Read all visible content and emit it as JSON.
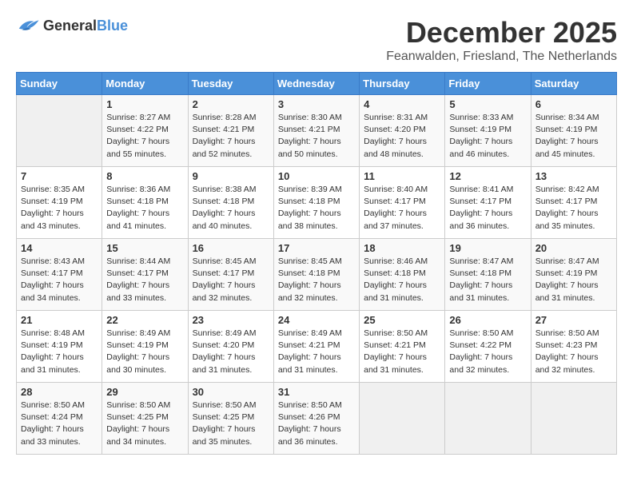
{
  "logo": {
    "general": "General",
    "blue": "Blue"
  },
  "title": "December 2025",
  "location": "Feanwalden, Friesland, The Netherlands",
  "days_of_week": [
    "Sunday",
    "Monday",
    "Tuesday",
    "Wednesday",
    "Thursday",
    "Friday",
    "Saturday"
  ],
  "weeks": [
    [
      {
        "day": "",
        "sunrise": "",
        "sunset": "",
        "daylight": ""
      },
      {
        "day": "1",
        "sunrise": "Sunrise: 8:27 AM",
        "sunset": "Sunset: 4:22 PM",
        "daylight": "Daylight: 7 hours and 55 minutes."
      },
      {
        "day": "2",
        "sunrise": "Sunrise: 8:28 AM",
        "sunset": "Sunset: 4:21 PM",
        "daylight": "Daylight: 7 hours and 52 minutes."
      },
      {
        "day": "3",
        "sunrise": "Sunrise: 8:30 AM",
        "sunset": "Sunset: 4:21 PM",
        "daylight": "Daylight: 7 hours and 50 minutes."
      },
      {
        "day": "4",
        "sunrise": "Sunrise: 8:31 AM",
        "sunset": "Sunset: 4:20 PM",
        "daylight": "Daylight: 7 hours and 48 minutes."
      },
      {
        "day": "5",
        "sunrise": "Sunrise: 8:33 AM",
        "sunset": "Sunset: 4:19 PM",
        "daylight": "Daylight: 7 hours and 46 minutes."
      },
      {
        "day": "6",
        "sunrise": "Sunrise: 8:34 AM",
        "sunset": "Sunset: 4:19 PM",
        "daylight": "Daylight: 7 hours and 45 minutes."
      }
    ],
    [
      {
        "day": "7",
        "sunrise": "Sunrise: 8:35 AM",
        "sunset": "Sunset: 4:19 PM",
        "daylight": "Daylight: 7 hours and 43 minutes."
      },
      {
        "day": "8",
        "sunrise": "Sunrise: 8:36 AM",
        "sunset": "Sunset: 4:18 PM",
        "daylight": "Daylight: 7 hours and 41 minutes."
      },
      {
        "day": "9",
        "sunrise": "Sunrise: 8:38 AM",
        "sunset": "Sunset: 4:18 PM",
        "daylight": "Daylight: 7 hours and 40 minutes."
      },
      {
        "day": "10",
        "sunrise": "Sunrise: 8:39 AM",
        "sunset": "Sunset: 4:18 PM",
        "daylight": "Daylight: 7 hours and 38 minutes."
      },
      {
        "day": "11",
        "sunrise": "Sunrise: 8:40 AM",
        "sunset": "Sunset: 4:17 PM",
        "daylight": "Daylight: 7 hours and 37 minutes."
      },
      {
        "day": "12",
        "sunrise": "Sunrise: 8:41 AM",
        "sunset": "Sunset: 4:17 PM",
        "daylight": "Daylight: 7 hours and 36 minutes."
      },
      {
        "day": "13",
        "sunrise": "Sunrise: 8:42 AM",
        "sunset": "Sunset: 4:17 PM",
        "daylight": "Daylight: 7 hours and 35 minutes."
      }
    ],
    [
      {
        "day": "14",
        "sunrise": "Sunrise: 8:43 AM",
        "sunset": "Sunset: 4:17 PM",
        "daylight": "Daylight: 7 hours and 34 minutes."
      },
      {
        "day": "15",
        "sunrise": "Sunrise: 8:44 AM",
        "sunset": "Sunset: 4:17 PM",
        "daylight": "Daylight: 7 hours and 33 minutes."
      },
      {
        "day": "16",
        "sunrise": "Sunrise: 8:45 AM",
        "sunset": "Sunset: 4:17 PM",
        "daylight": "Daylight: 7 hours and 32 minutes."
      },
      {
        "day": "17",
        "sunrise": "Sunrise: 8:45 AM",
        "sunset": "Sunset: 4:18 PM",
        "daylight": "Daylight: 7 hours and 32 minutes."
      },
      {
        "day": "18",
        "sunrise": "Sunrise: 8:46 AM",
        "sunset": "Sunset: 4:18 PM",
        "daylight": "Daylight: 7 hours and 31 minutes."
      },
      {
        "day": "19",
        "sunrise": "Sunrise: 8:47 AM",
        "sunset": "Sunset: 4:18 PM",
        "daylight": "Daylight: 7 hours and 31 minutes."
      },
      {
        "day": "20",
        "sunrise": "Sunrise: 8:47 AM",
        "sunset": "Sunset: 4:19 PM",
        "daylight": "Daylight: 7 hours and 31 minutes."
      }
    ],
    [
      {
        "day": "21",
        "sunrise": "Sunrise: 8:48 AM",
        "sunset": "Sunset: 4:19 PM",
        "daylight": "Daylight: 7 hours and 31 minutes."
      },
      {
        "day": "22",
        "sunrise": "Sunrise: 8:49 AM",
        "sunset": "Sunset: 4:19 PM",
        "daylight": "Daylight: 7 hours and 30 minutes."
      },
      {
        "day": "23",
        "sunrise": "Sunrise: 8:49 AM",
        "sunset": "Sunset: 4:20 PM",
        "daylight": "Daylight: 7 hours and 31 minutes."
      },
      {
        "day": "24",
        "sunrise": "Sunrise: 8:49 AM",
        "sunset": "Sunset: 4:21 PM",
        "daylight": "Daylight: 7 hours and 31 minutes."
      },
      {
        "day": "25",
        "sunrise": "Sunrise: 8:50 AM",
        "sunset": "Sunset: 4:21 PM",
        "daylight": "Daylight: 7 hours and 31 minutes."
      },
      {
        "day": "26",
        "sunrise": "Sunrise: 8:50 AM",
        "sunset": "Sunset: 4:22 PM",
        "daylight": "Daylight: 7 hours and 32 minutes."
      },
      {
        "day": "27",
        "sunrise": "Sunrise: 8:50 AM",
        "sunset": "Sunset: 4:23 PM",
        "daylight": "Daylight: 7 hours and 32 minutes."
      }
    ],
    [
      {
        "day": "28",
        "sunrise": "Sunrise: 8:50 AM",
        "sunset": "Sunset: 4:24 PM",
        "daylight": "Daylight: 7 hours and 33 minutes."
      },
      {
        "day": "29",
        "sunrise": "Sunrise: 8:50 AM",
        "sunset": "Sunset: 4:25 PM",
        "daylight": "Daylight: 7 hours and 34 minutes."
      },
      {
        "day": "30",
        "sunrise": "Sunrise: 8:50 AM",
        "sunset": "Sunset: 4:25 PM",
        "daylight": "Daylight: 7 hours and 35 minutes."
      },
      {
        "day": "31",
        "sunrise": "Sunrise: 8:50 AM",
        "sunset": "Sunset: 4:26 PM",
        "daylight": "Daylight: 7 hours and 36 minutes."
      },
      {
        "day": "",
        "sunrise": "",
        "sunset": "",
        "daylight": ""
      },
      {
        "day": "",
        "sunrise": "",
        "sunset": "",
        "daylight": ""
      },
      {
        "day": "",
        "sunrise": "",
        "sunset": "",
        "daylight": ""
      }
    ]
  ]
}
